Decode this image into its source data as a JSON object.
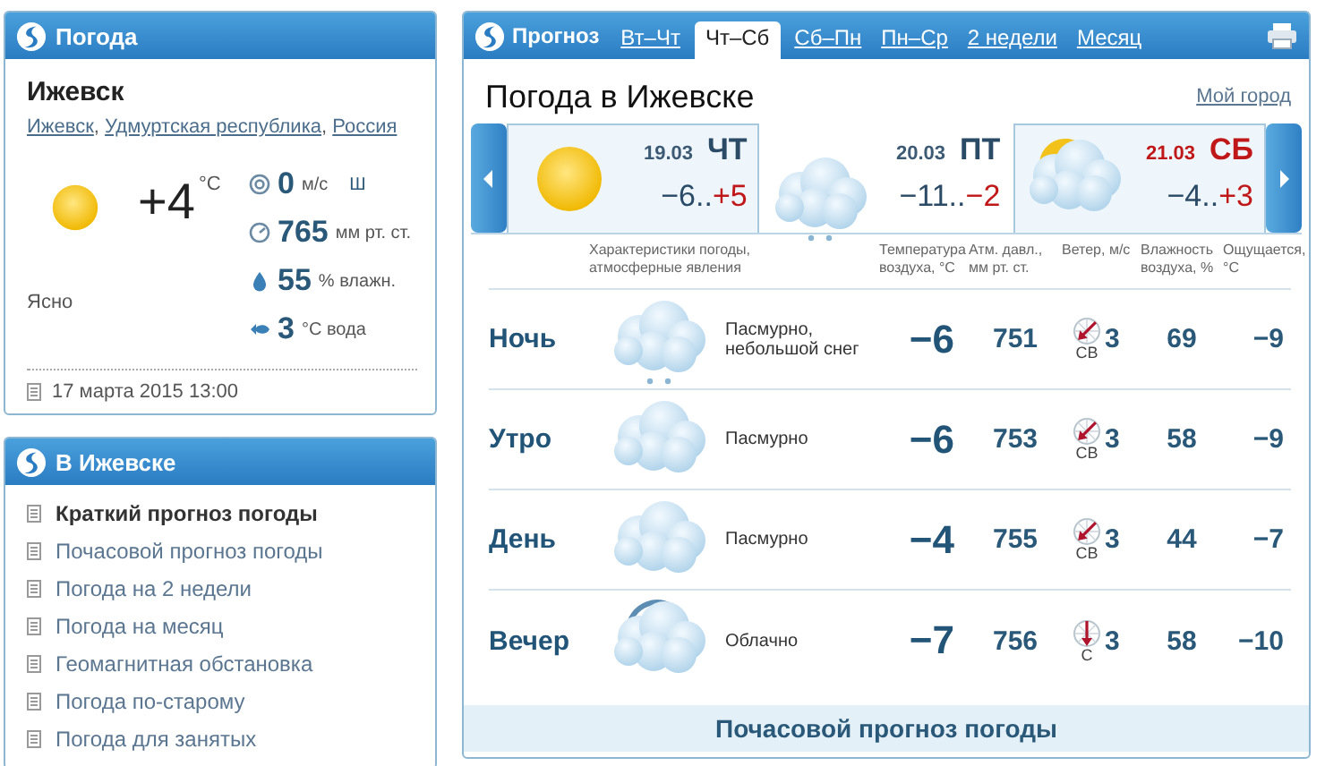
{
  "current": {
    "header": "Погода",
    "city": "Ижевск",
    "breadcrumbs": [
      {
        "label": "Ижевск",
        "after": ","
      },
      {
        "label": "Удмуртская республика",
        "after": ","
      },
      {
        "label": "Россия"
      }
    ],
    "kind": "sunny",
    "temp": "+4",
    "temp_unit": "°C",
    "condition": "Ясно",
    "stats": [
      {
        "kind": "wind",
        "value": "0",
        "unit": "м/с",
        "extra": "Ш"
      },
      {
        "kind": "pressure",
        "value": "765",
        "unit": "мм рт. ст."
      },
      {
        "kind": "humidity",
        "value": "55",
        "unit": "% влажн."
      },
      {
        "kind": "water",
        "value": "3",
        "unit": "°C вода"
      }
    ],
    "updated": "17 марта 2015 13:00"
  },
  "city_menu": {
    "header": "В Ижевске",
    "items": [
      {
        "label": "Краткий прогноз погоды",
        "selected": true
      },
      {
        "label": "Почасовой прогноз погоды",
        "selected": false
      },
      {
        "label": "Погода на 2 недели",
        "selected": false
      },
      {
        "label": "Погода на месяц",
        "selected": false
      },
      {
        "label": "Геомагнитная обстановка",
        "selected": false
      },
      {
        "label": "Погода по-старому",
        "selected": false
      },
      {
        "label": "Погода для занятых",
        "selected": false
      }
    ]
  },
  "forecast": {
    "header": "Прогноз",
    "tabs": [
      {
        "label": "Вт–Чт",
        "selected": false
      },
      {
        "label": "Чт–Сб",
        "selected": true
      },
      {
        "label": "Сб–Пн",
        "selected": false
      },
      {
        "label": "Пн–Ср",
        "selected": false
      },
      {
        "label": "2 недели",
        "selected": false
      },
      {
        "label": "Месяц",
        "selected": false
      }
    ],
    "title": "Погода в Ижевске",
    "my_city": "Мой город",
    "days": [
      {
        "date": "19.03",
        "weekday": "ЧТ",
        "weekend": false,
        "low": "−6..",
        "high": "+5",
        "high_warm": true,
        "kind": "sunny",
        "selected": false
      },
      {
        "date": "20.03",
        "weekday": "ПТ",
        "weekend": false,
        "low": "−11..",
        "high": "−2",
        "high_warm": true,
        "kind": "snow",
        "selected": true
      },
      {
        "date": "21.03",
        "weekday": "СБ",
        "weekend": true,
        "low": "−4..",
        "high": "+3",
        "high_warm": true,
        "kind": "partly",
        "selected": false
      }
    ],
    "columns": [
      "Характеристики погоды, атмосферные явления",
      "Температура воздуха, °C",
      "Атм. давл., мм рт. ст.",
      "Ветер, м/с",
      "Влажность воздуха, %",
      "Ощущается, °C"
    ],
    "rows": [
      {
        "period": "Ночь",
        "kind": "snow",
        "description": "Пасмурно, небольшой снег",
        "temp": "−6",
        "pressure": "751",
        "wind": {
          "kind": "ne",
          "speed": "3",
          "direction": "СВ"
        },
        "humidity": "69",
        "feels": "−9"
      },
      {
        "period": "Утро",
        "kind": "overcast",
        "description": "Пасмурно",
        "temp": "−6",
        "pressure": "753",
        "wind": {
          "kind": "ne",
          "speed": "3",
          "direction": "СВ"
        },
        "humidity": "58",
        "feels": "−9"
      },
      {
        "period": "День",
        "kind": "overcast",
        "description": "Пасмурно",
        "temp": "−4",
        "pressure": "755",
        "wind": {
          "kind": "ne",
          "speed": "3",
          "direction": "СВ"
        },
        "humidity": "44",
        "feels": "−7"
      },
      {
        "period": "Вечер",
        "kind": "cloudy",
        "description": "Облачно",
        "temp": "−7",
        "pressure": "756",
        "wind": {
          "kind": "n",
          "speed": "3",
          "direction": "С"
        },
        "humidity": "58",
        "feels": "−10"
      }
    ],
    "footer_link": "Почасовой прогноз погоды"
  }
}
